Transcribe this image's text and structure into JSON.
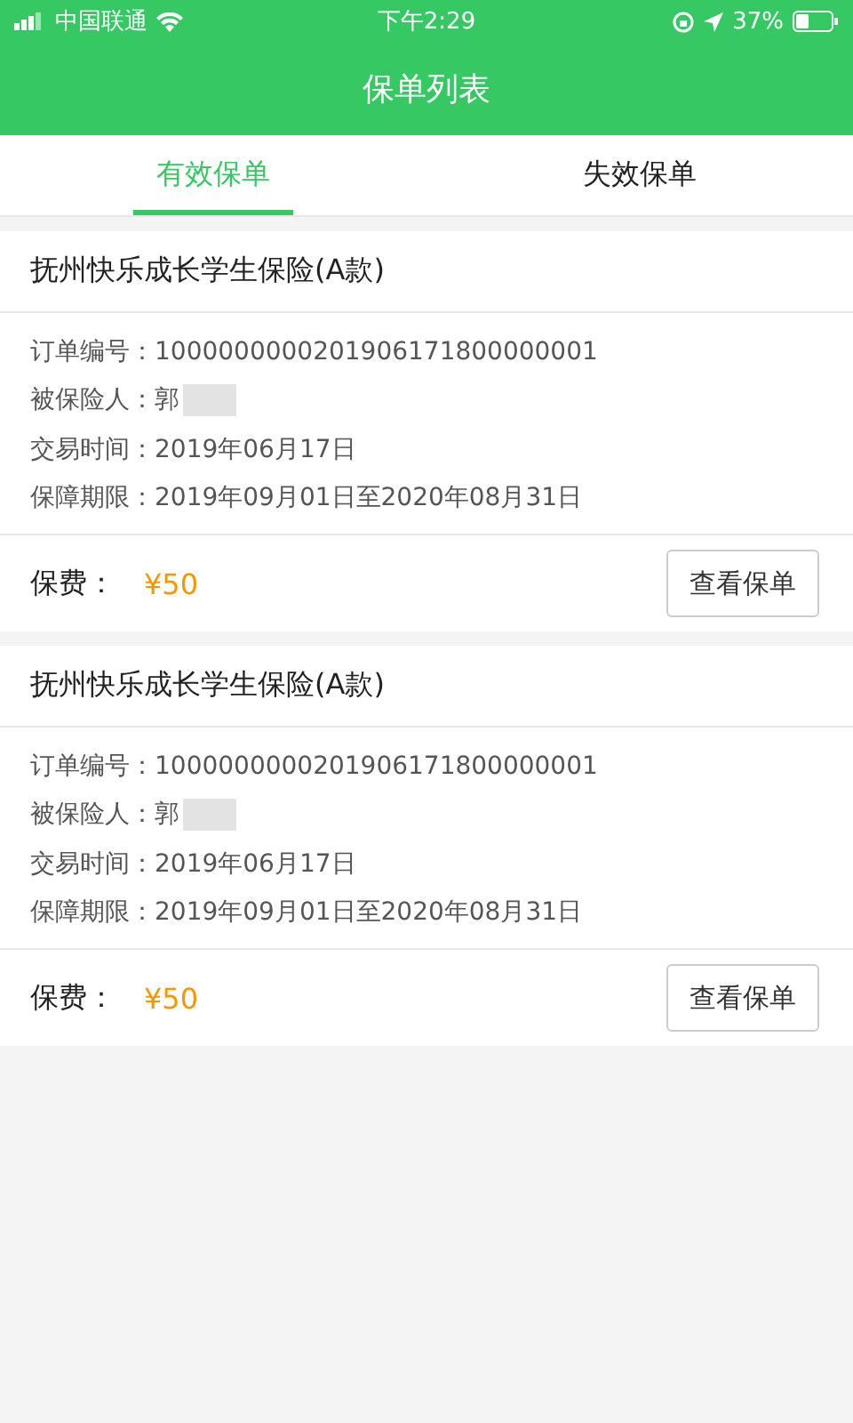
{
  "status_bar": {
    "carrier": "中国联通",
    "time": "下午2:29",
    "battery": "37%"
  },
  "header": {
    "title": "保单列表"
  },
  "tabs": [
    {
      "label": "有效保单",
      "selected": true
    },
    {
      "label": "失效保单",
      "selected": false
    }
  ],
  "policies": [
    {
      "name": "抚州快乐成长学生保险(A款)",
      "fields": [
        {
          "label": "订单编号：",
          "value": "1000000000201906171800000001",
          "redacted": false
        },
        {
          "label": "被保险人：",
          "value": "郭",
          "redacted": true
        },
        {
          "label": "交易时间：",
          "value": "2019年06月17日",
          "redacted": false
        },
        {
          "label": "保障期限：",
          "value": "2019年09月01日至2020年08月31日",
          "redacted": false
        }
      ],
      "premium_label": "保费：",
      "premium": "¥50",
      "button": "查看保单"
    },
    {
      "name": "抚州快乐成长学生保险(A款)",
      "fields": [
        {
          "label": "订单编号：",
          "value": "1000000000201906171800000001",
          "redacted": false
        },
        {
          "label": "被保险人：",
          "value": "郭",
          "redacted": true
        },
        {
          "label": "交易时间：",
          "value": "2019年06月17日",
          "redacted": false
        },
        {
          "label": "保障期限：",
          "value": "2019年09月01日至2020年08月31日",
          "redacted": false
        }
      ],
      "premium_label": "保费：",
      "premium": "¥50",
      "button": "查看保单"
    }
  ]
}
